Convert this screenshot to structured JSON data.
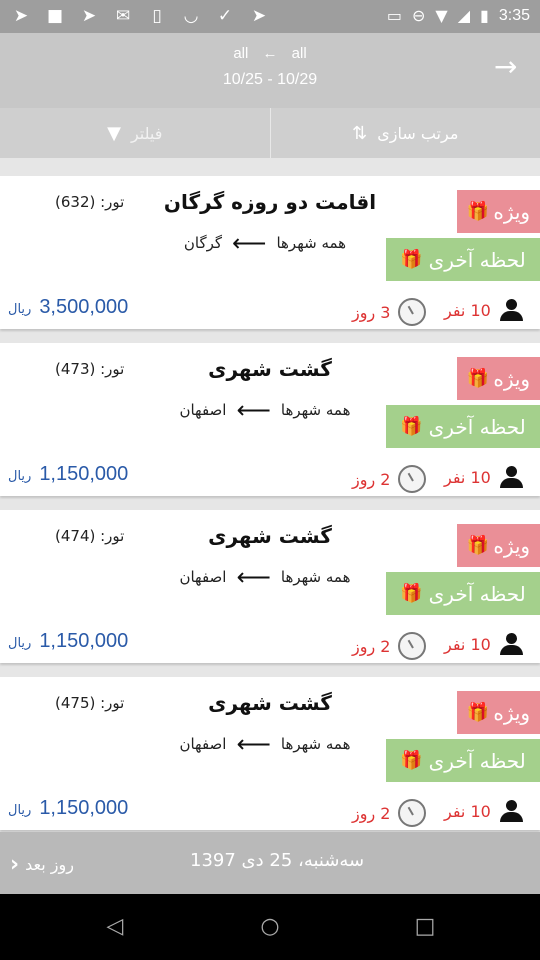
{
  "status_bar": {
    "time": "3:35",
    "left_icons": [
      "paper-plane-icon",
      "square-icon",
      "paper-plane-icon",
      "gmail-icon",
      "phone-icon",
      "pocket-icon",
      "checkmark-icon",
      "paper-plane-icon"
    ],
    "right_icons": [
      "cast-icon",
      "do-not-disturb-icon",
      "wifi-icon",
      "no-signal-icon",
      "battery-charging-icon"
    ]
  },
  "header": {
    "origin": "all",
    "destination": "all",
    "date_range": "10/25 - 10/29"
  },
  "toolbar": {
    "sort_label": "مرتب سازی",
    "filter_label": "فیلتر"
  },
  "tours": [
    {
      "title": "اقامت دو روزه گرگان",
      "tour_number": "تور: (632)",
      "from": "همه شهرها",
      "to": "گرگان",
      "badge_special": "ویژه",
      "badge_last_minute": "لحظه آخری",
      "people": "10 نفر",
      "days": "3 روز",
      "price": "3,500,000",
      "currency": "ریال"
    },
    {
      "title": "گشت شهری",
      "tour_number": "تور: (473)",
      "from": "همه شهرها",
      "to": "اصفهان",
      "badge_special": "ویژه",
      "badge_last_minute": "لحظه آخری",
      "people": "10 نفر",
      "days": "2 روز",
      "price": "1,150,000",
      "currency": "ریال"
    },
    {
      "title": "گشت شهری",
      "tour_number": "تور: (474)",
      "from": "همه شهرها",
      "to": "اصفهان",
      "badge_special": "ویژه",
      "badge_last_minute": "لحظه آخری",
      "people": "10 نفر",
      "days": "2 روز",
      "price": "1,150,000",
      "currency": "ریال"
    },
    {
      "title": "گشت شهری",
      "tour_number": "تور: (475)",
      "from": "همه شهرها",
      "to": "اصفهان",
      "badge_special": "ویژه",
      "badge_last_minute": "لحظه آخری",
      "people": "10 نفر",
      "days": "2 روز",
      "price": "1,150,000",
      "currency": "ریال"
    }
  ],
  "date_bar": {
    "current_date": "سه‌شنبه، 25 دی 1397",
    "next_label": "روز بعد"
  },
  "colors": {
    "special_badge": "#ea8f97",
    "last_minute_badge": "#a4d08c",
    "price": "#2a5aa8",
    "red_text": "#dd3333"
  }
}
